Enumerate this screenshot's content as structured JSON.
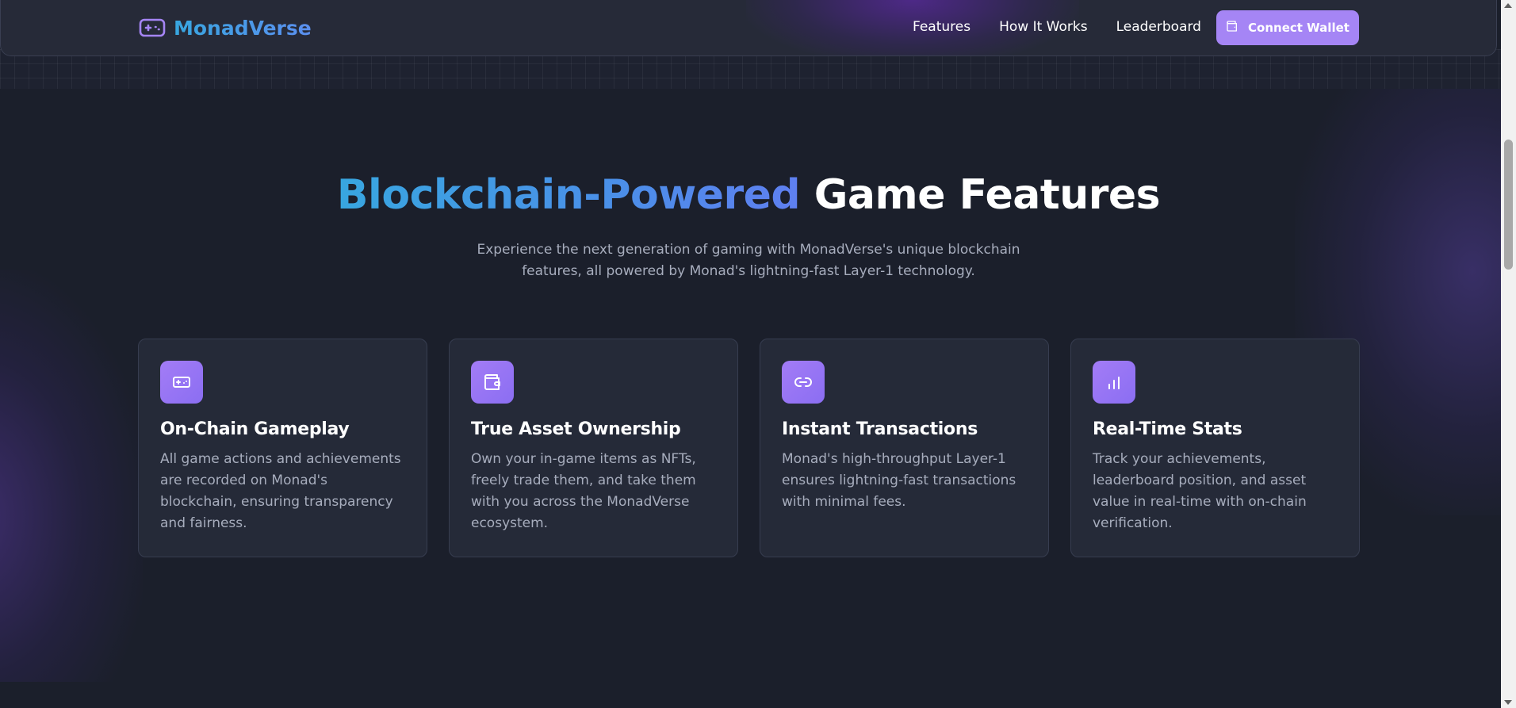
{
  "nav": {
    "brand": "MonadVerse",
    "links": [
      "Features",
      "How It Works",
      "Leaderboard"
    ],
    "wallet_button": "Connect Wallet"
  },
  "hero": {
    "title_accent": "Blockchain-Powered",
    "title_rest": "Game Features",
    "subtitle": "Experience the next generation of gaming with MonadVerse's unique blockchain features, all powered by Monad's lightning-fast Layer-1 technology."
  },
  "features": [
    {
      "icon": "gamepad-icon",
      "title": "On-Chain Gameplay",
      "description": "All game actions and achievements are recorded on Monad's blockchain, ensuring transparency and fairness."
    },
    {
      "icon": "wallet-icon",
      "title": "True Asset Ownership",
      "description": "Own your in-game items as NFTs, freely trade them, and take them with you across the MonadVerse ecosystem."
    },
    {
      "icon": "link-icon",
      "title": "Instant Transactions",
      "description": "Monad's high-throughput Layer-1 ensures lightning-fast transactions with minimal fees."
    },
    {
      "icon": "bar-chart-icon",
      "title": "Real-Time Stats",
      "description": "Track your achievements, leaderboard position, and asset value in real-time with on-chain verification."
    }
  ],
  "colors": {
    "background": "#1b1f2b",
    "card": "#252a38",
    "accent_purple": "#a585f5",
    "accent_blue": "#38a6e0",
    "muted_text": "#a7adbd"
  }
}
